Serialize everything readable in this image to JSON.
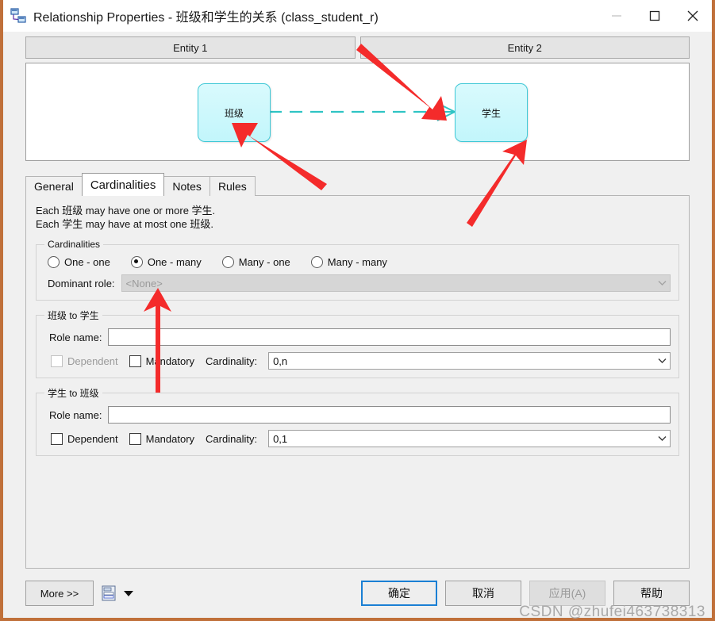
{
  "window": {
    "title": "Relationship Properties - 班级和学生的关系 (class_student_r)",
    "icon": "relationship-icon",
    "minimize_label": "–",
    "maximize_label": "□",
    "close_label": "✕"
  },
  "entity_headers": [
    {
      "label": "Entity 1"
    },
    {
      "label": "Entity 2"
    }
  ],
  "diagram": {
    "entity_left": "班级",
    "entity_right": "学生",
    "link_style": "dashed",
    "link_color": "#2fc4c4",
    "entity_border_color": "#3fc8d6",
    "entity_fill_color": "#d2f8fc"
  },
  "tabs": [
    {
      "label": "General",
      "active": false
    },
    {
      "label": "Cardinalities",
      "active": true
    },
    {
      "label": "Notes",
      "active": false
    },
    {
      "label": "Rules",
      "active": false
    }
  ],
  "description": {
    "line1": "Each 班级 may have one or more 学生.",
    "line2": "Each 学生 may have at most one 班级."
  },
  "cardinalities": {
    "legend": "Cardinalities",
    "options": [
      {
        "label": "One - one",
        "selected": false
      },
      {
        "label": "One - many",
        "selected": true
      },
      {
        "label": "Many - one",
        "selected": false
      },
      {
        "label": "Many - many",
        "selected": false
      }
    ],
    "dominant_role_label": "Dominant role:",
    "dominant_role_value": "<None>",
    "dominant_role_disabled": true
  },
  "role_a": {
    "legend": "班级 to 学生",
    "role_name_label": "Role name:",
    "role_name_value": "",
    "dependent_label": "Dependent",
    "dependent_checked": false,
    "dependent_disabled": true,
    "mandatory_label": "Mandatory",
    "mandatory_checked": false,
    "cardinality_label": "Cardinality:",
    "cardinality_value": "0,n"
  },
  "role_b": {
    "legend": "学生 to 班级",
    "role_name_label": "Role name:",
    "role_name_value": "",
    "dependent_label": "Dependent",
    "dependent_checked": false,
    "dependent_disabled": false,
    "mandatory_label": "Mandatory",
    "mandatory_checked": false,
    "cardinality_label": "Cardinality:",
    "cardinality_value": "0,1"
  },
  "footer": {
    "more_label": "More >>",
    "report_icon": "report-icon",
    "ok_label": "确定",
    "cancel_label": "取消",
    "apply_label": "应用(A)",
    "apply_disabled": true,
    "help_label": "帮助"
  },
  "watermark": "CSDN @zhufei463738313",
  "colors": {
    "accent": "#1a7fd4",
    "annotation_arrow": "#f42b2b",
    "window_border": "#c0703a",
    "dialog_bg": "#f0f0f0"
  }
}
